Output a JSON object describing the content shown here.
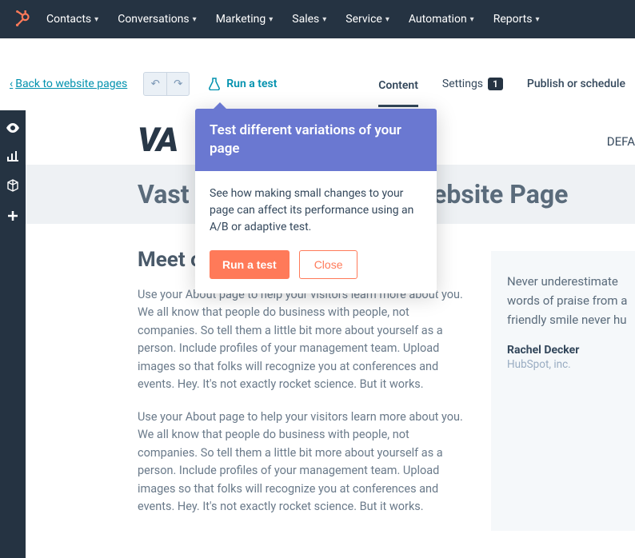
{
  "nav": {
    "items": [
      {
        "label": "Contacts"
      },
      {
        "label": "Conversations"
      },
      {
        "label": "Marketing"
      },
      {
        "label": "Sales"
      },
      {
        "label": "Service"
      },
      {
        "label": "Automation"
      },
      {
        "label": "Reports"
      }
    ]
  },
  "toolbar": {
    "back_label": "Back to website pages",
    "run_test": "Run a test",
    "tabs": {
      "content": "Content",
      "settings": "Settings",
      "settings_badge": "1",
      "publish": "Publish or schedule"
    }
  },
  "page": {
    "brand_fragment": "VA",
    "default_frag": "DEFA",
    "title_obscured": "Vast T                                   ebsite Page",
    "section_heading": "Meet our team",
    "para": "Use your About page to help your visitors learn more about you. We all know that people do business with people, not companies. So tell them a little bit more about yourself as a person. Include profiles of your management team. Upload images so that folks will recognize you at conferences and events. Hey. It's not exactly rocket science. But it works."
  },
  "quote": {
    "text": "Never underestimate words of praise from a friendly smile never hu",
    "author": "Rachel Decker",
    "company": "HubSpot, inc."
  },
  "popover": {
    "title": "Test different variations of your page",
    "body": "See how making small changes to your page can affect its performance using an A/B or adaptive test.",
    "primary": "Run a test",
    "secondary": "Close"
  }
}
